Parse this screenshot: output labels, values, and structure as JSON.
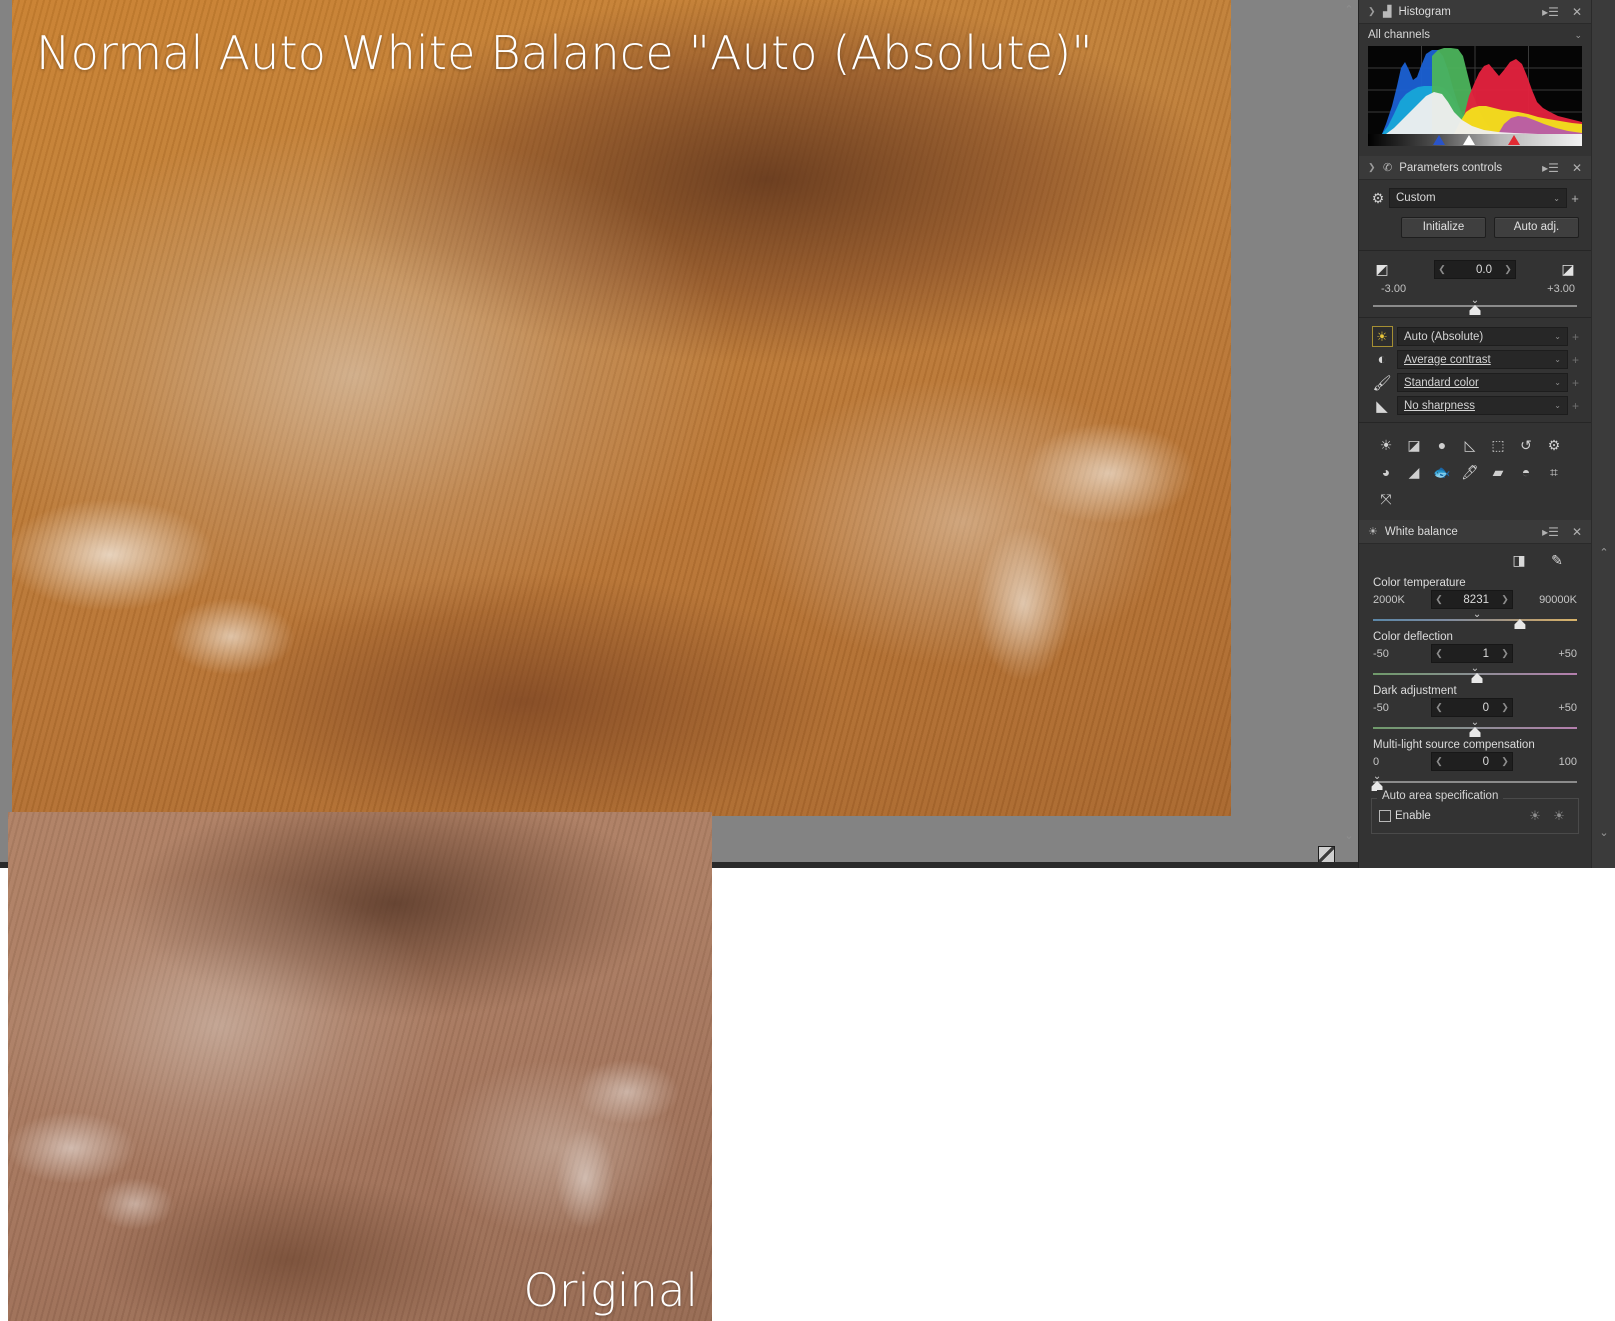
{
  "canvas": {
    "main_image_caption": "Normal Auto White Balance \"Auto (Absolute)\"",
    "original_image_caption": "Original",
    "resize_grip_icon": "resize-grip-icon"
  },
  "histogram_panel": {
    "title": "Histogram",
    "twisty_icon": "chevron-right-icon",
    "panel_icon": "histogram-icon",
    "menu_icon": "panel-menu-icon",
    "close_icon": "close-icon",
    "channel_select": "All channels",
    "channel_caret_icon": "chevron-down-icon",
    "markers": [
      {
        "name": "black-point-marker",
        "color": "#2a54c8",
        "position_pct": 33
      },
      {
        "name": "midpoint-marker",
        "color": "#ffffff",
        "position_pct": 47
      },
      {
        "name": "white-point-marker",
        "color": "#e12a33",
        "position_pct": 68
      }
    ]
  },
  "parameters_panel": {
    "title": "Parameters controls",
    "twisty_icon": "chevron-right-icon",
    "panel_icon": "parameters-icon",
    "menu_icon": "panel-menu-icon",
    "close_icon": "close-icon",
    "preset": {
      "gear_icon": "gear-icon",
      "value": "Custom",
      "caret_icon": "chevron-down-icon",
      "add_icon": "plus-icon"
    },
    "buttons": {
      "initialize": "Initialize",
      "auto_adjust": "Auto adj."
    },
    "exposure": {
      "left_icon": "exposure-icon",
      "right_icon": "exposure-region-icon",
      "value": "0.0",
      "min_label": "-3.00",
      "max_label": "+3.00",
      "dec_icon": "chevron-left-icon",
      "inc_icon": "chevron-right-icon",
      "thumb_pct": 50
    },
    "dropdowns": [
      {
        "icon": "sun-icon",
        "label": "Auto (Absolute)",
        "underline": false,
        "selected": true
      },
      {
        "icon": "contrast-icon",
        "label": "Average contrast",
        "underline": true,
        "selected": false
      },
      {
        "icon": "color-icon",
        "label": "Standard color",
        "underline": true,
        "selected": false
      },
      {
        "icon": "sharpness-icon",
        "label": "No sharpness",
        "underline": true,
        "selected": false
      }
    ],
    "tools": [
      "brightness-tool-icon",
      "tone-curve-tool-icon",
      "shadow-tool-icon",
      "gradient-tool-icon",
      "crop-marquee-tool-icon",
      "rotate-tool-icon",
      "settings-tool-icon",
      "dodge-tool-icon",
      "vignette-tool-icon",
      "fisheye-tool-icon",
      "brush-tool-icon",
      "eraser-tool-icon",
      "blur-tool-icon",
      "crop-tool-icon",
      "transform-tool-icon"
    ]
  },
  "white_balance_panel": {
    "title": "White balance",
    "panel_icon": "sun-icon",
    "menu_icon": "panel-menu-icon",
    "close_icon": "close-icon",
    "pickers": [
      "white-balance-picker-icon",
      "white-balance-picker-alt-icon"
    ],
    "sliders": [
      {
        "name": "color-temperature",
        "label": "Color temperature",
        "min_label": "2000K",
        "max_label": "90000K",
        "value": "8231",
        "thumb_pct": 72,
        "gradient": "temp"
      },
      {
        "name": "color-deflection",
        "label": "Color deflection",
        "min_label": "-50",
        "max_label": "+50",
        "value": "1",
        "thumb_pct": 51,
        "gradient": "tint"
      },
      {
        "name": "dark-adjustment",
        "label": "Dark adjustment",
        "min_label": "-50",
        "max_label": "+50",
        "value": "0",
        "thumb_pct": 50,
        "gradient": "tint"
      },
      {
        "name": "multi-light-source-compensation",
        "label": "Multi-light source compensation",
        "min_label": "0",
        "max_label": "100",
        "value": "0",
        "thumb_pct": 2,
        "gradient": "plain"
      }
    ],
    "auto_area": {
      "legend": "Auto area specification",
      "enable_label": "Enable",
      "enabled": false,
      "icons": [
        "auto-area-set-icon",
        "auto-area-clear-icon"
      ]
    }
  },
  "dock_edge": {
    "collapse_up_icon": "chevron-up-icon",
    "collapse_down_icon": "chevron-down-icon"
  }
}
